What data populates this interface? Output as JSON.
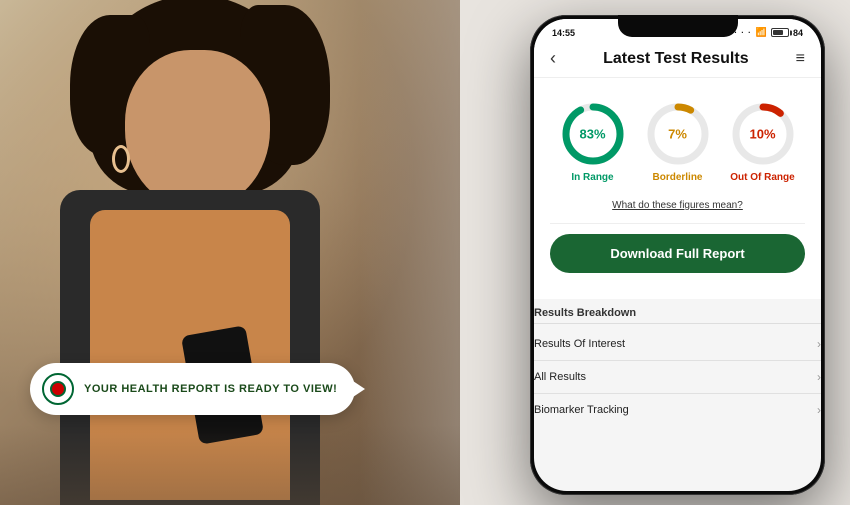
{
  "background": {
    "colors": {
      "bg": "#c8b89a",
      "person_skin": "#c8956a",
      "hair": "#1a0f05",
      "clothing": "#2a2a2a",
      "top": "#c8854a"
    }
  },
  "notification": {
    "text": "YOUR HEALTH REPORT IS READY TO VIEW!"
  },
  "phone": {
    "status_bar": {
      "time": "14:55",
      "battery": "84"
    },
    "header": {
      "back_label": "‹",
      "title": "Latest Test Results",
      "menu_icon": "≡"
    },
    "charts": [
      {
        "id": "in-range",
        "percent": 83,
        "label_value": "83%",
        "label_name": "In Range",
        "color": "#009966",
        "circumference": 188.5,
        "dash": 156.5
      },
      {
        "id": "borderline",
        "percent": 7,
        "label_value": "7%",
        "label_name": "Borderline",
        "color": "#cc8800",
        "circumference": 188.5,
        "dash": 13.2
      },
      {
        "id": "out-of-range",
        "percent": 10,
        "label_value": "10%",
        "label_name": "Out Of Range",
        "color": "#cc2200",
        "circumference": 188.5,
        "dash": 18.85
      }
    ],
    "figures_link": "What do these figures mean?",
    "download_button": "Download Full Report",
    "breakdown": {
      "title": "Results Breakdown",
      "items": [
        {
          "label": "Results Of Interest",
          "chevron": "›"
        },
        {
          "label": "All Results",
          "chevron": "›"
        },
        {
          "label": "Biomarker Tracking",
          "chevron": "›"
        }
      ]
    }
  }
}
